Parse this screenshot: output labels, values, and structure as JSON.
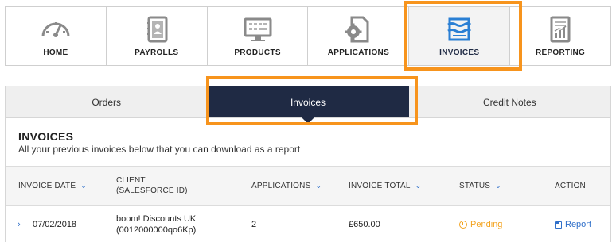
{
  "nav": {
    "items": [
      {
        "label": "HOME",
        "icon": "gauge-icon"
      },
      {
        "label": "PAYROLLS",
        "icon": "contact-card-icon"
      },
      {
        "label": "PRODUCTS",
        "icon": "monitor-icon"
      },
      {
        "label": "APPLICATIONS",
        "icon": "gear-document-icon"
      },
      {
        "label": "INVOICES",
        "icon": "receipt-icon",
        "active": true
      },
      {
        "label": "REPORTING",
        "icon": "report-chart-icon"
      }
    ]
  },
  "subtabs": [
    {
      "label": "Orders"
    },
    {
      "label": "Invoices",
      "active": true
    },
    {
      "label": "Credit Notes"
    }
  ],
  "section": {
    "title": "INVOICES",
    "subtitle": "All your previous invoices below that you can download as a report"
  },
  "table": {
    "columns": {
      "invoice_date": "INVOICE DATE",
      "client_line1": "CLIENT",
      "client_line2": "(SALESFORCE ID)",
      "applications": "APPLICATIONS",
      "invoice_total": "INVOICE TOTAL",
      "status": "STATUS",
      "action": "ACTION"
    },
    "rows": [
      {
        "invoice_date": "07/02/2018",
        "client_name": "boom! Discounts UK",
        "client_id": "(0012000000qo6Kp)",
        "applications": "2",
        "invoice_total": "£650.00",
        "status": "Pending",
        "action": "Report"
      }
    ]
  },
  "colors": {
    "accent_navy": "#1f2a44",
    "highlight_orange": "#f7941d",
    "link_blue": "#2f6fc9",
    "pending_amber": "#f3a31f",
    "active_icon_blue": "#2a7fd4"
  }
}
